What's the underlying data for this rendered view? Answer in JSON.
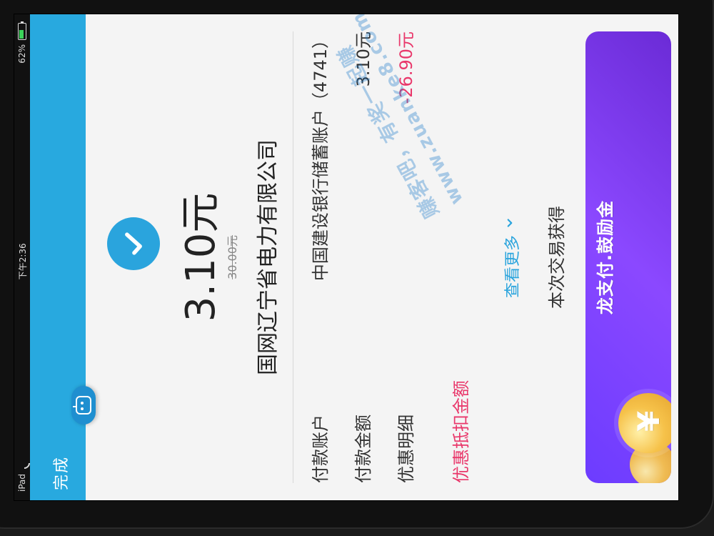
{
  "status_bar": {
    "left_device": "iPad",
    "time": "下午2:36",
    "battery_percent": "62%"
  },
  "header": {
    "done_label": "完成"
  },
  "payment": {
    "amount": "3.10元",
    "original_amount": "30.00元",
    "merchant": "国网辽宁省电力有限公司"
  },
  "details": {
    "account_label": "付款账户",
    "account_value": "中国建设银行储蓄账户（4741）",
    "paid_label": "付款金额",
    "paid_value": "3.10元",
    "discount_label": "优惠明细",
    "discount_item_label": "优惠抵扣金额",
    "discount_value": "-26.90元"
  },
  "actions": {
    "see_more": "查看更多"
  },
  "earned": {
    "text": "本次交易获得"
  },
  "promo": {
    "title": "龙支付.鼓励金"
  },
  "watermark": {
    "line1": "赚客吧，有奖一起赚",
    "line2": "www.zuanke8.com"
  },
  "colors": {
    "header_blue": "#28a9df",
    "success_blue": "#2aa4dd",
    "discount_pink": "#e9386b",
    "promo_purple": "#7a3dff"
  }
}
